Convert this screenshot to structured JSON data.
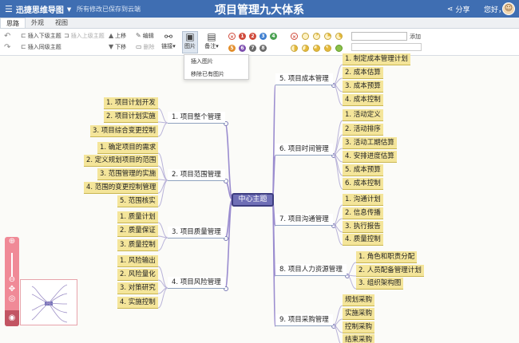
{
  "header": {
    "brand": "迅捷思维导图",
    "save_status": "所有修改已保存到云端",
    "doc_title": "项目管理九大体系",
    "share": "分享",
    "greeting": "您好，"
  },
  "tabs": [
    "思路",
    "外观",
    "视图"
  ],
  "toolbar": {
    "insert_child": "插入下级主题",
    "insert_parent": "插入上级主题",
    "insert_sibling": "插入同级主题",
    "move_up": "上移",
    "move_down": "下移",
    "edit": "编辑",
    "delete": "删除",
    "link": "链接",
    "image": "图片",
    "note": "备注",
    "priority_icons": [
      "1",
      "2",
      "3",
      "4",
      "5",
      "6",
      "7",
      "8"
    ],
    "priority_colors": [
      "#d04b3c",
      "#d04b3c",
      "#3f7fd0",
      "#4aa152",
      "#e28e2c",
      "#7f51b0",
      "#6b6b6b",
      "#6b6b6b"
    ],
    "find": "添加"
  },
  "image_menu": [
    "插入图片",
    "移除已有图片"
  ],
  "center": "中心主题",
  "branches_left": [
    {
      "title": "1. 项目整个管理",
      "children": [
        "1. 项目计划开发",
        "2. 项目计划实施",
        "3. 项目综合变更控制"
      ]
    },
    {
      "title": "2. 项目范围管理",
      "children": [
        "1. 确定项目的需求",
        "2. 定义规划项目的范围",
        "3. 范围管理的实施",
        "4. 范围的变更控制管理",
        "5. 范围核实"
      ]
    },
    {
      "title": "3. 项目质量管理",
      "children": [
        "1. 质量计划",
        "2. 质量保证",
        "3. 质量控制"
      ]
    },
    {
      "title": "4. 项目风险管理",
      "children": [
        "1. 风险输出",
        "2. 风险量化",
        "3. 对策研究",
        "4. 实施控制"
      ]
    }
  ],
  "branches_right": [
    {
      "title": "5. 项目成本管理",
      "children": [
        "1. 制定成本管理计划",
        "2. 成本估算",
        "3. 成本预算",
        "4. 成本控制"
      ]
    },
    {
      "title": "6. 项目时间管理",
      "children": [
        "1. 活动定义",
        "2. 活动排序",
        "3. 活动工期估算",
        "4. 安排进度估算",
        "5. 成本预算",
        "6. 成本控制"
      ]
    },
    {
      "title": "7. 项目沟通管理",
      "children": [
        "1. 沟通计划",
        "2. 信息传播",
        "3. 执行报告",
        "4. 质量控制"
      ]
    },
    {
      "title": "8. 项目人力资源管理",
      "children": [
        "1. 角色和职责分配",
        "2. 人员配备管理计划",
        "3. 组织架构图"
      ]
    },
    {
      "title": "9. 项目采购管理",
      "children": [
        "规划采购",
        "实施采购",
        "控制采购",
        "结束采购"
      ]
    }
  ]
}
